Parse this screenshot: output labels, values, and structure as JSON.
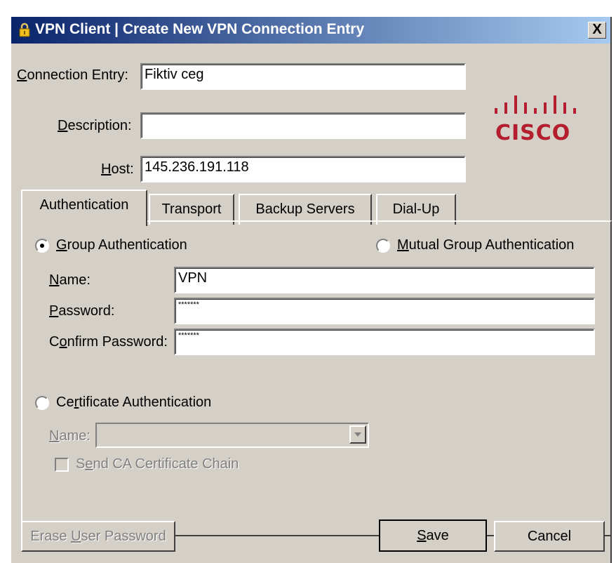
{
  "window": {
    "title": "VPN Client  |  Create New VPN Connection Entry",
    "close_label": "X"
  },
  "brand": {
    "logo_text": "CISCO",
    "logo_color": "#b41e2e"
  },
  "fields": {
    "connection_entry": {
      "prefix": "C",
      "rest": "onnection Entry:",
      "value": "Fiktiv ceg"
    },
    "description": {
      "prefix": "D",
      "rest": "escription:",
      "value": ""
    },
    "host": {
      "prefix": "H",
      "rest": "ost:",
      "value": "145.236.191.118"
    }
  },
  "tabs": [
    "Authentication",
    "Transport",
    "Backup Servers",
    "Dial-Up"
  ],
  "auth": {
    "group_auth": {
      "prefix": "G",
      "rest": "roup Authentication",
      "selected": true
    },
    "mutual_auth": {
      "prefix": "M",
      "rest": "utual Group Authentication",
      "selected": false
    },
    "name": {
      "prefix": "N",
      "rest": "ame:",
      "value": "VPN"
    },
    "password": {
      "prefix": "P",
      "rest": "assword:",
      "value": "*******"
    },
    "confirm_password": {
      "pre": "C",
      "u": "o",
      "rest": "nfirm Password:",
      "value": "*******"
    },
    "cert_auth": {
      "pre": "Ce",
      "u": "r",
      "rest": "tificate Authentication",
      "selected": false
    },
    "cert_name": {
      "prefix": "N",
      "rest": "ame:",
      "value": ""
    },
    "send_ca": {
      "pre": "S",
      "u": "e",
      "rest": "nd CA Certificate Chain",
      "checked": false
    }
  },
  "buttons": {
    "erase": {
      "pre": "Erase ",
      "u": "U",
      "rest": "ser Password"
    },
    "save": {
      "u": "S",
      "rest": "ave"
    },
    "cancel": "Cancel"
  }
}
